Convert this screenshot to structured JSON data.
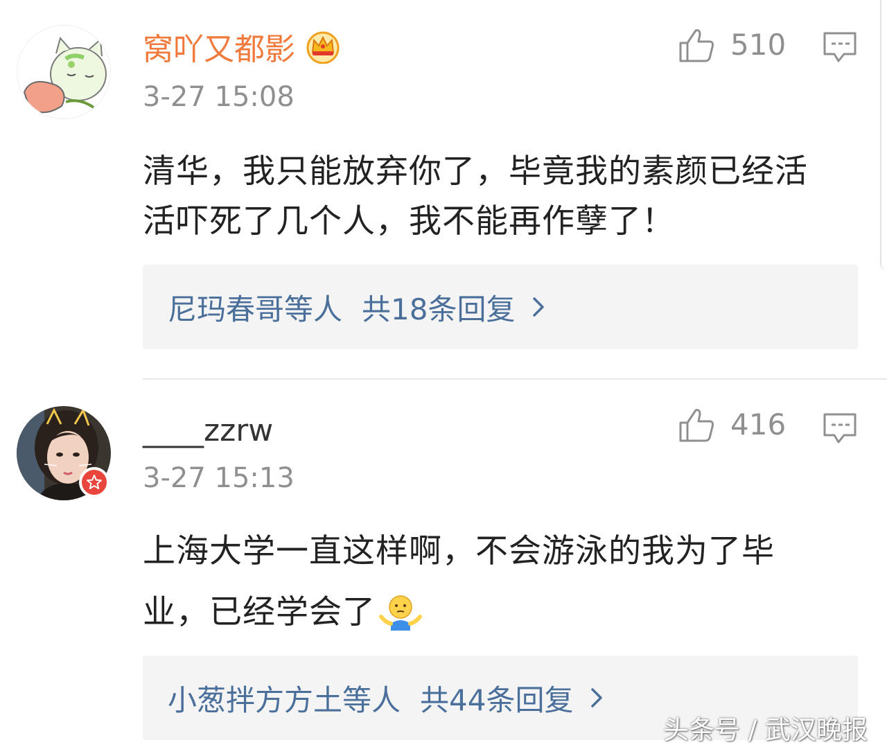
{
  "colors": {
    "vip_username": "#f07a3c",
    "normal_username": "#333333",
    "reply_link": "#4a6f9a",
    "meta_gray": "#8f8f8f",
    "reply_box_bg": "#f4f4f4",
    "vip_badge": "#e8453c"
  },
  "comments": [
    {
      "username": "窝吖又都影",
      "user_type": "vip",
      "badge_icon": "crown-icon",
      "avatar_icon": "cartoon-cat-avatar",
      "timestamp": "3-27 15:08",
      "likes": "510",
      "text_lines": [
        "清华，我只能放弃你了，毕竟我的素颜已经活",
        "活吓死了几个人，我不能再作孽了！"
      ],
      "reply_users": "尼玛春哥等人",
      "reply_count": "共18条回复"
    },
    {
      "username": "____zzrw",
      "user_type": "normal",
      "badge_icon": "verified-star-icon",
      "avatar_icon": "user-photo-avatar",
      "timestamp": "3-27 15:13",
      "likes": "416",
      "text_lines": [
        "上海大学一直这样啊，不会游泳的我为了毕",
        "业，已经学会了"
      ],
      "emoji_icon": "shrug-emoji-icon",
      "reply_users": "小葱拌方方土等人",
      "reply_count": "共44条回复"
    }
  ],
  "watermark": "头条号 / 武汉晚报"
}
